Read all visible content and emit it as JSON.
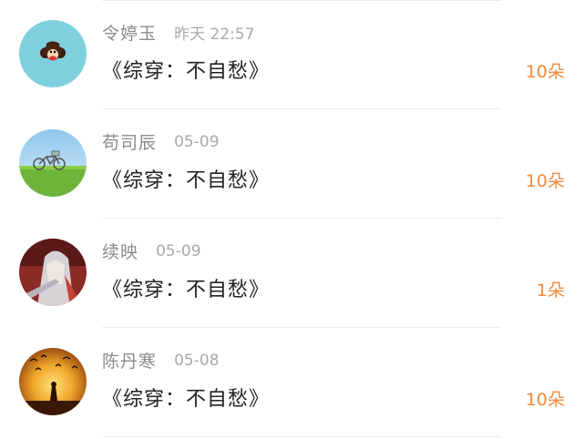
{
  "items": [
    {
      "sender": "令婷玉",
      "time": "昨天 22:57",
      "book": "《综穿：不自愁》",
      "gift": "10朵",
      "avatar_icon": "monkey-face-icon",
      "avatar_color": "#7fd0de"
    },
    {
      "sender": "苟司辰",
      "time": "05-09",
      "book": "《综穿：不自愁》",
      "gift": "10朵",
      "avatar_icon": "bicycle-field-icon",
      "avatar_color": "#6fb43a"
    },
    {
      "sender": "续映",
      "time": "05-09",
      "book": "《综穿：不自愁》",
      "gift": "1朵",
      "avatar_icon": "anime-character-icon",
      "avatar_color": "#8a2b25"
    },
    {
      "sender": "陈丹寒",
      "time": "05-08",
      "book": "《综穿：不自愁》",
      "gift": "10朵",
      "avatar_icon": "sunset-birds-icon",
      "avatar_color": "#e8a020"
    }
  ],
  "colors": {
    "gift": "#f08a3c",
    "sender": "#8b8b8b",
    "time": "#a9a9a9",
    "book": "#222222"
  }
}
